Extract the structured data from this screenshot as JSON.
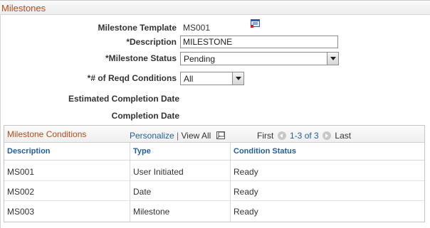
{
  "section": {
    "title": "Milestones"
  },
  "form": {
    "template_label": "Milestone Template",
    "template_value": "MS001",
    "description_label": "*Description",
    "description_value": "MILESTONE",
    "status_label": "*Milestone Status",
    "status_value": "Pending",
    "reqd_label": "*# of Reqd Conditions",
    "reqd_value": "All",
    "est_completion_label": "Estimated Completion Date",
    "completion_label": "Completion Date"
  },
  "grid": {
    "title": "Milestone Conditions",
    "personalize": "Personalize",
    "separator": "|",
    "view_all": "View All",
    "first": "First",
    "range": "1-3 of 3",
    "last": "Last",
    "columns": [
      "Description",
      "Type",
      "Condition Status"
    ],
    "rows": [
      {
        "description": "MS001",
        "type": "User Initiated",
        "status": "Ready"
      },
      {
        "description": "MS002",
        "type": "Date",
        "status": "Ready"
      },
      {
        "description": "MS003",
        "type": "Milestone",
        "status": "Ready"
      }
    ]
  },
  "colors": {
    "title": "#b54a1a",
    "link": "#1f5f9f"
  },
  "icons": {
    "lookup": "lookup-icon",
    "zoom": "zoom-icon",
    "prev": "prev-arrow-icon",
    "next": "next-arrow-icon"
  }
}
